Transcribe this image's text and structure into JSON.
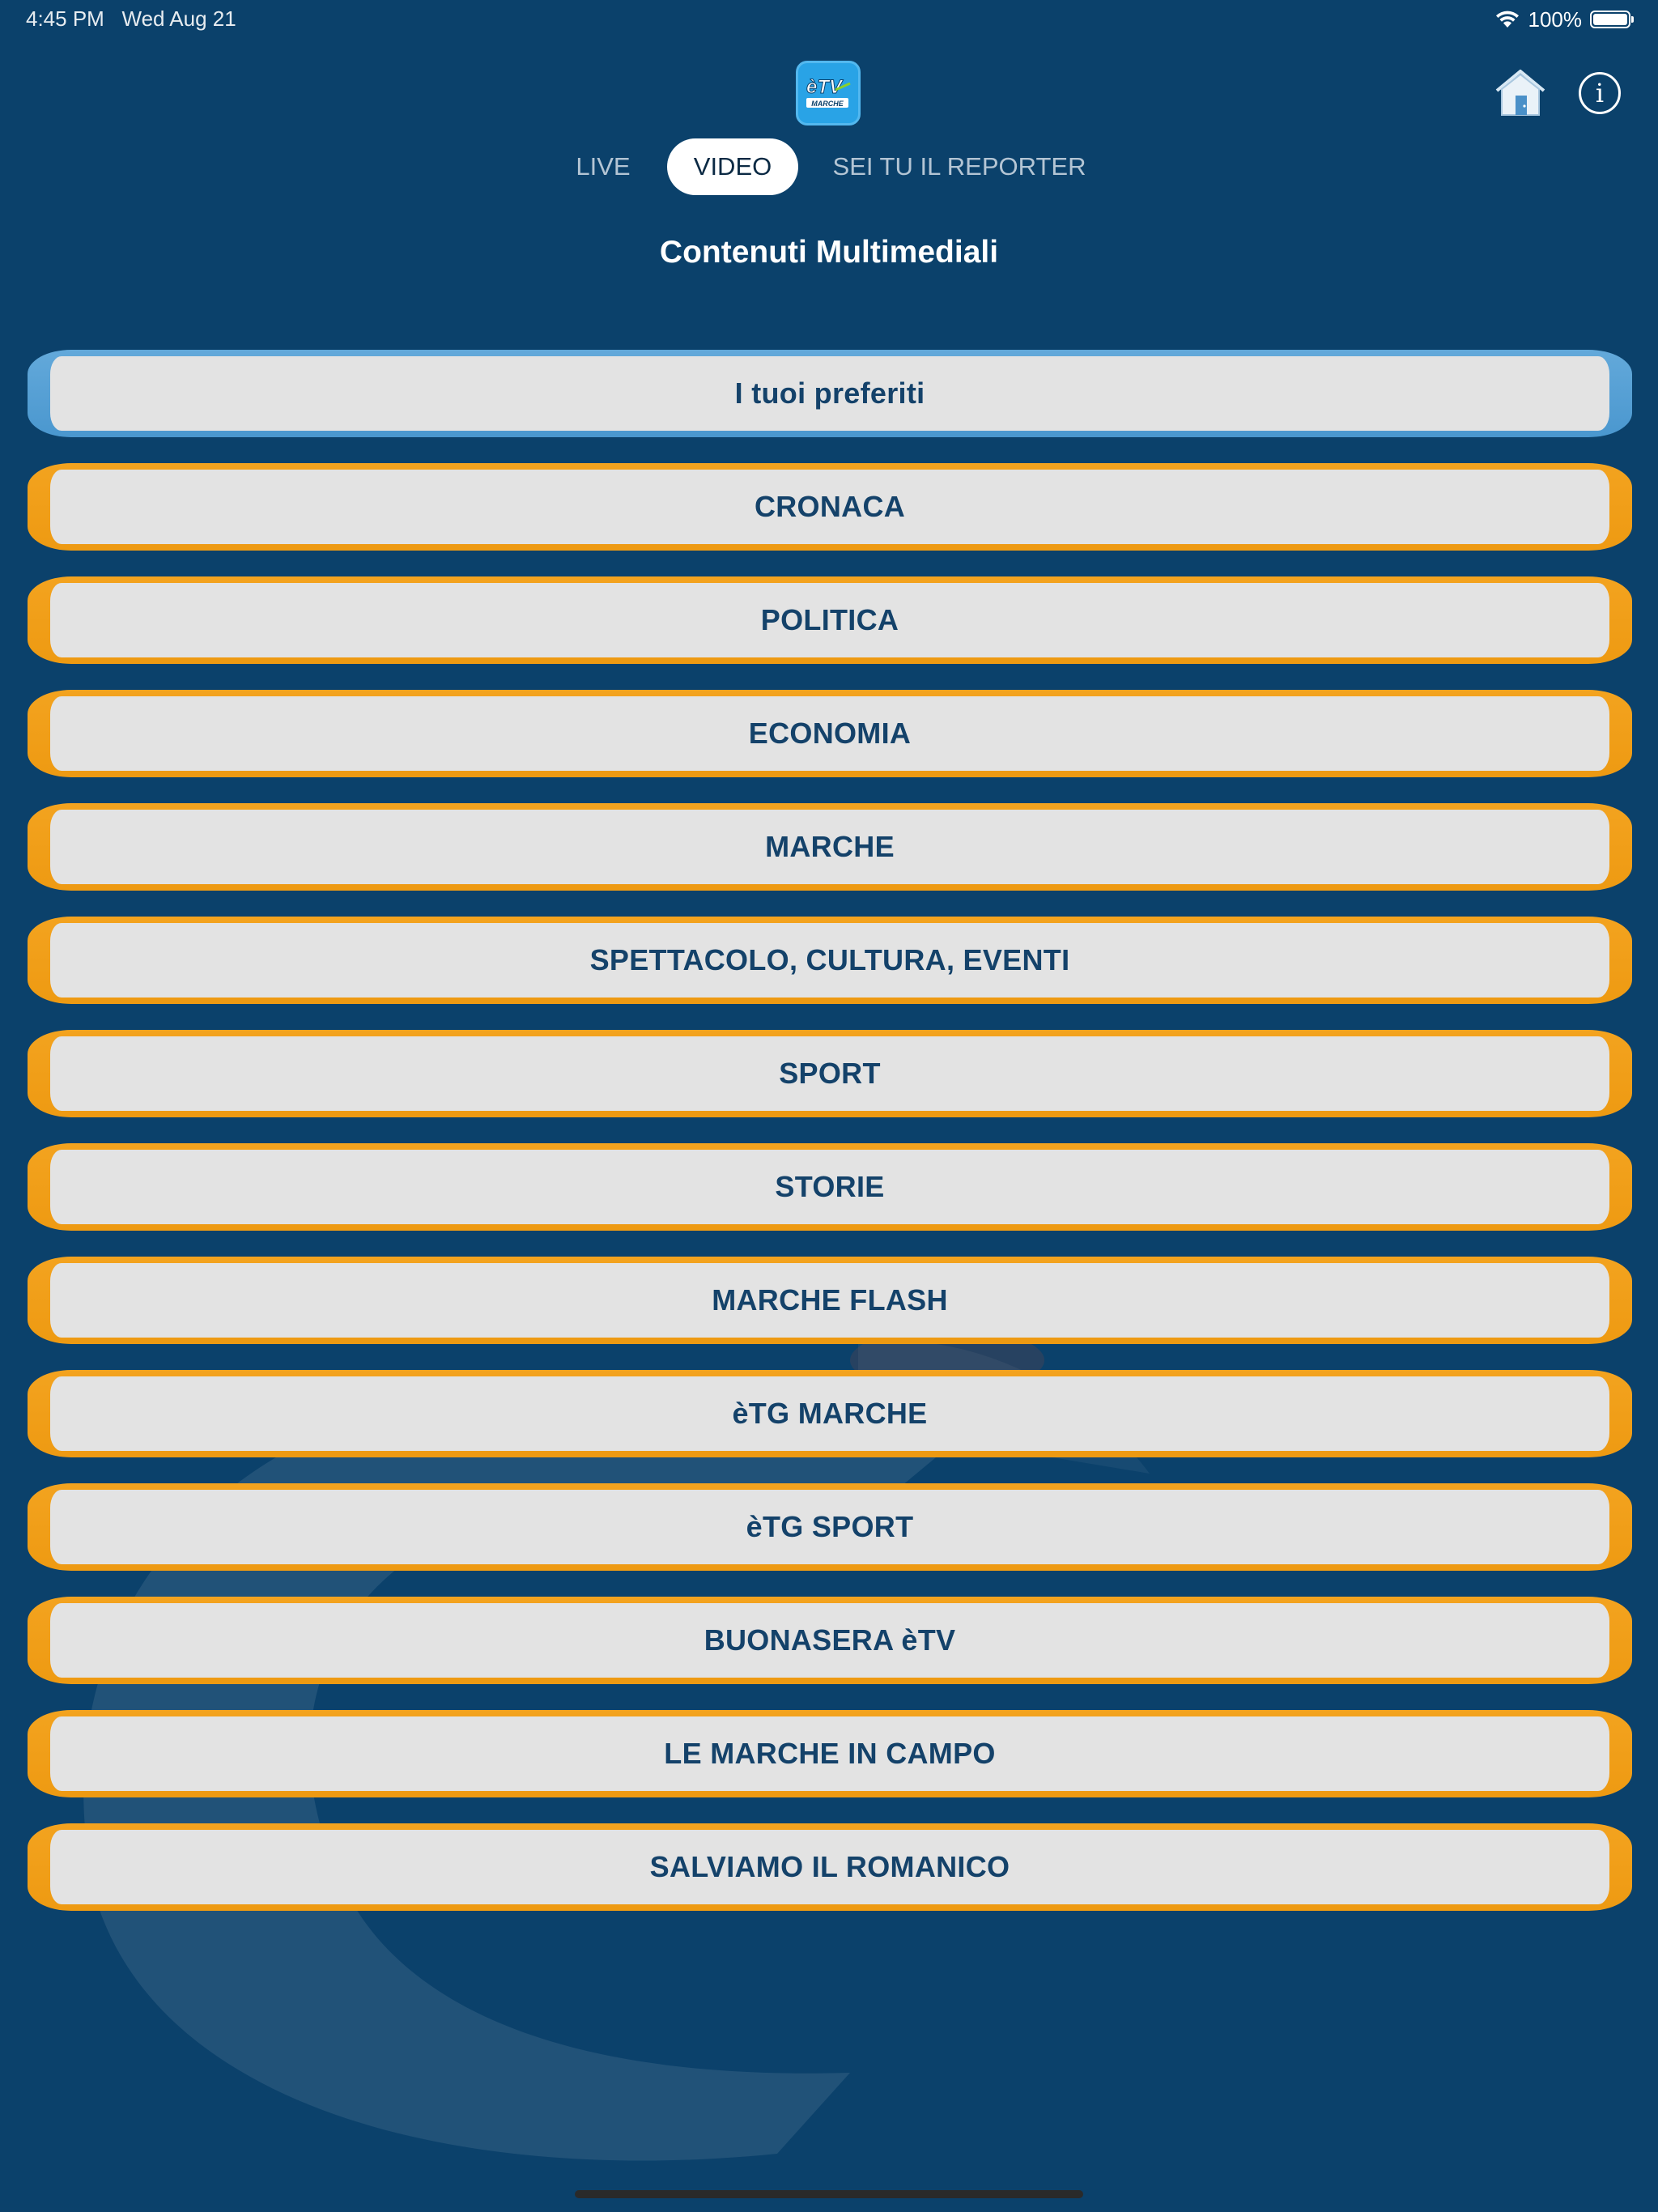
{
  "status_bar": {
    "time": "4:45 PM",
    "date": "Wed Aug 21",
    "battery": "100%"
  },
  "app": {
    "logo_text": "èTV",
    "logo_subtext": "MARCHE"
  },
  "icons": {
    "home": "home-icon",
    "info": "info-icon",
    "wifi": "wifi-icon",
    "battery": "battery-icon"
  },
  "tabs": [
    {
      "label": "LIVE",
      "selected": false
    },
    {
      "label": "VIDEO",
      "selected": true
    },
    {
      "label": "SEI TU IL REPORTER",
      "selected": false
    }
  ],
  "page": {
    "title": "Contenuti Multimediali"
  },
  "categories": [
    {
      "label": "I tuoi preferiti"
    },
    {
      "label": "CRONACA"
    },
    {
      "label": "POLITICA"
    },
    {
      "label": "ECONOMIA"
    },
    {
      "label": "MARCHE"
    },
    {
      "label": "SPETTACOLO, CULTURA, EVENTI"
    },
    {
      "label": "SPORT"
    },
    {
      "label": "STORIE"
    },
    {
      "label": "MARCHE FLASH"
    },
    {
      "label": "èTG MARCHE"
    },
    {
      "label": "èTG SPORT"
    },
    {
      "label": "BUONASERA èTV"
    },
    {
      "label": "LE MARCHE IN CAMPO"
    },
    {
      "label": "SALVIAMO IL ROMANICO"
    }
  ],
  "colors": {
    "background": "#0b416b",
    "favorites_frame": "#5aa2d6",
    "category_frame": "#f3a31f",
    "button_fill": "#e3e3e3",
    "button_text": "#14426a"
  }
}
